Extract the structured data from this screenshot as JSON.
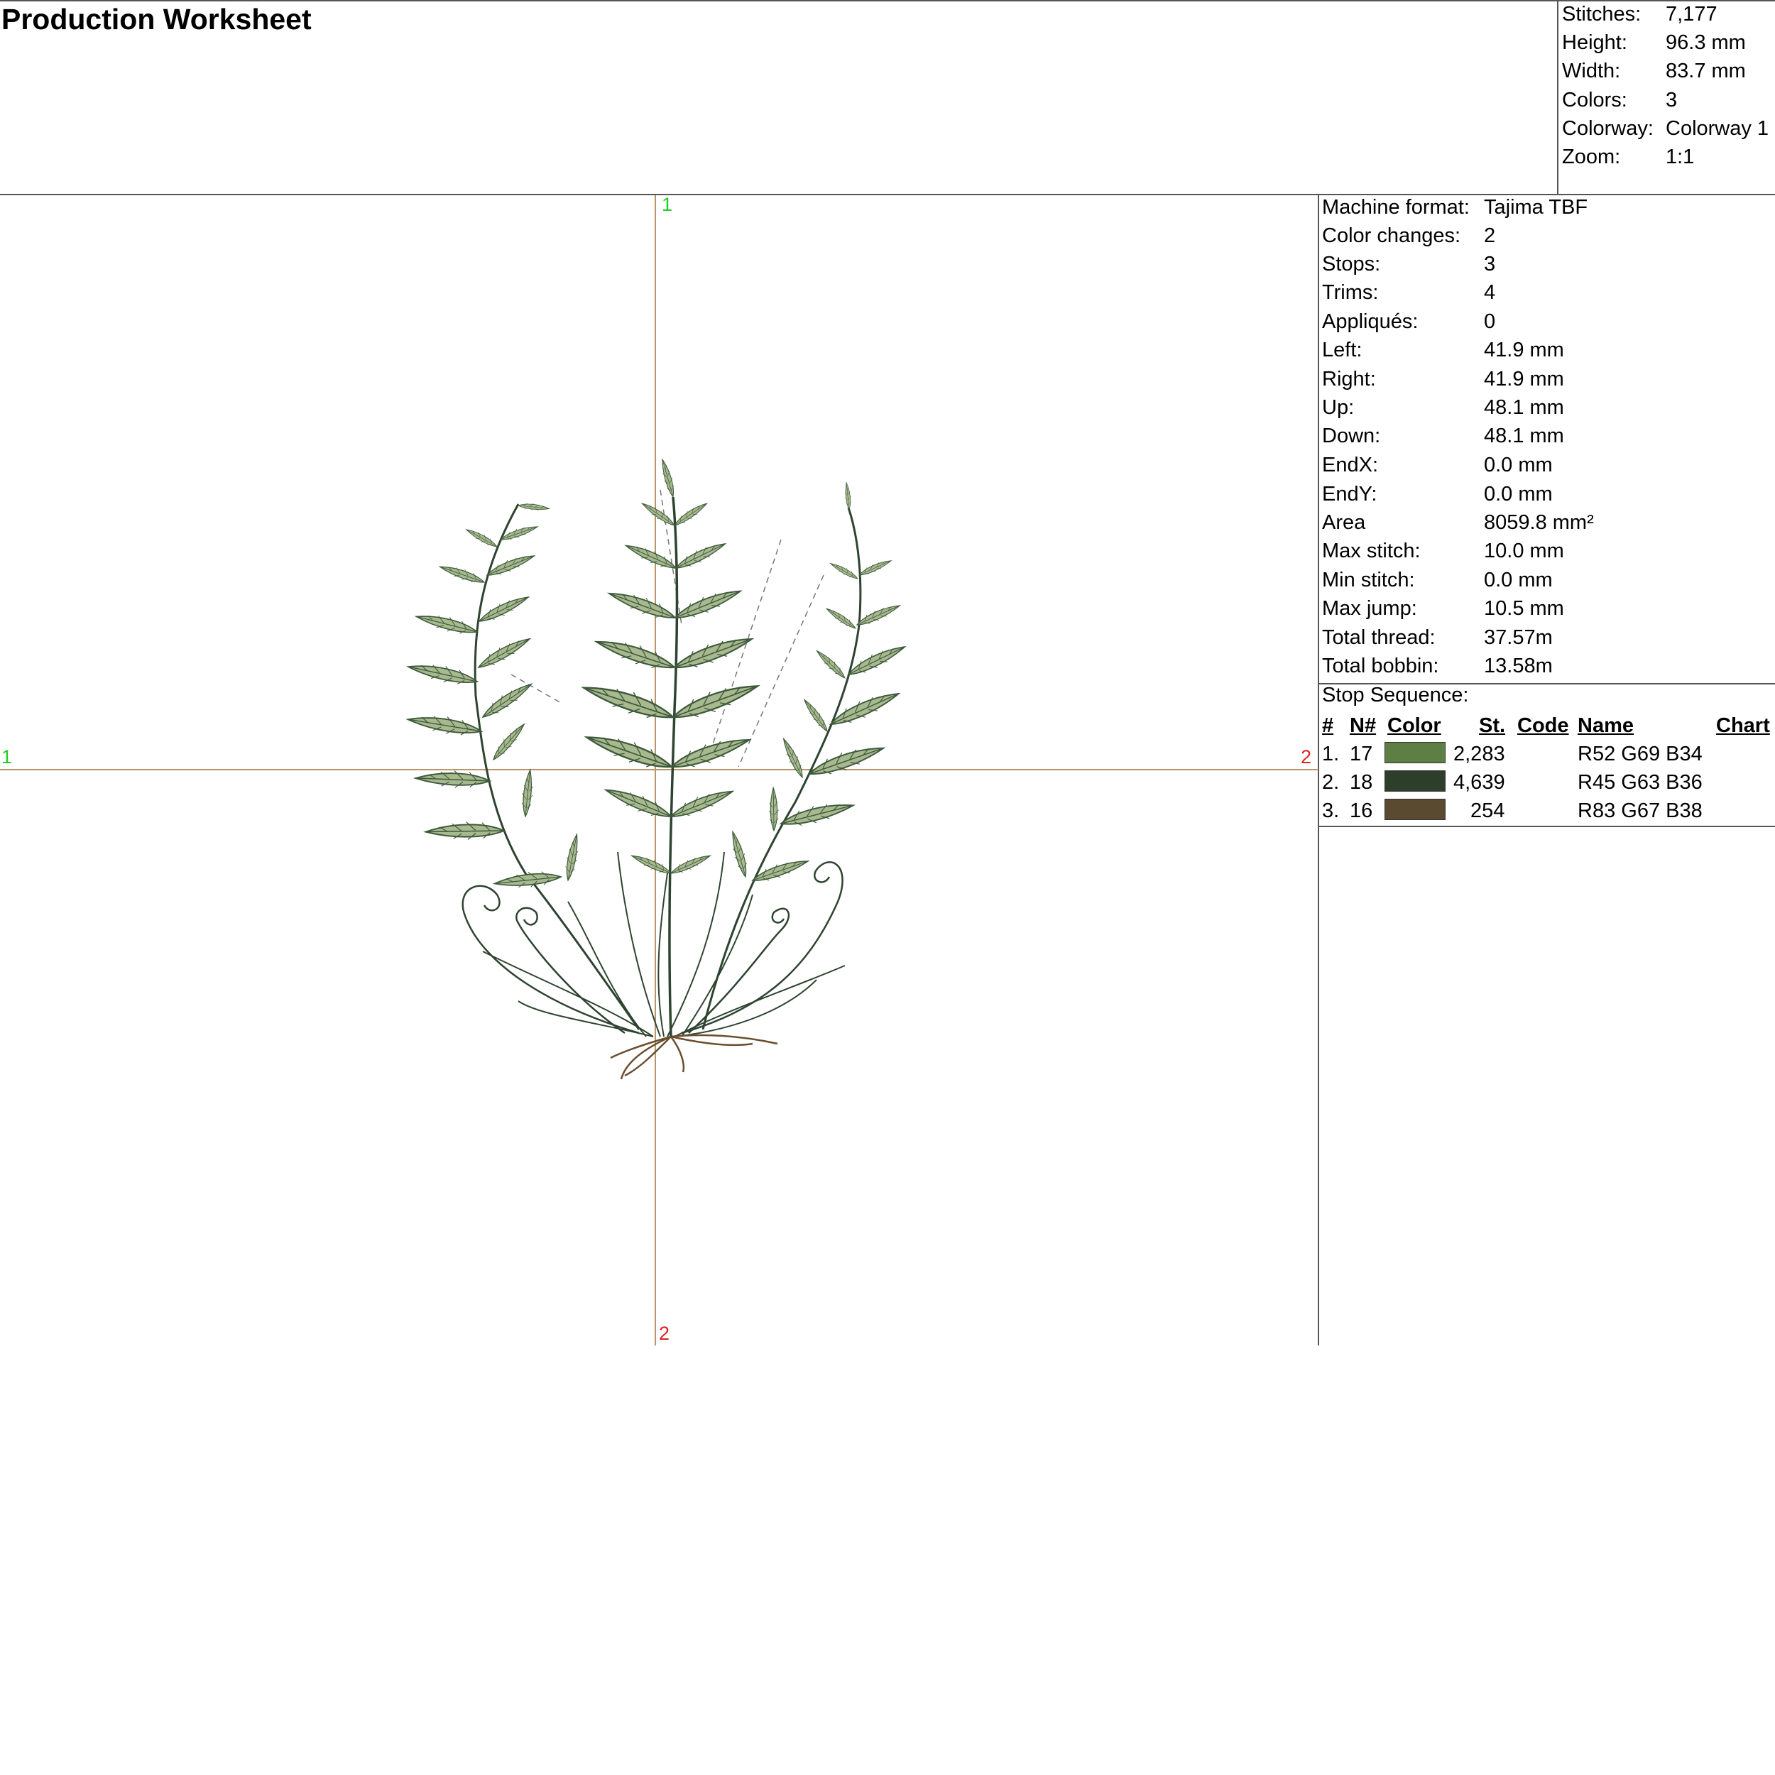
{
  "title": "Production Worksheet",
  "summary": [
    {
      "label": "Stitches:",
      "value": "7,177"
    },
    {
      "label": "Height:",
      "value": "96.3 mm"
    },
    {
      "label": "Width:",
      "value": "83.7 mm"
    },
    {
      "label": "Colors:",
      "value": "3"
    },
    {
      "label": "Colorway:",
      "value": "Colorway 1"
    },
    {
      "label": "Zoom:",
      "value": "1:1"
    }
  ],
  "details": [
    {
      "label": "Machine format:",
      "value": "Tajima TBF"
    },
    {
      "label": "Color changes:",
      "value": "2"
    },
    {
      "label": "Stops:",
      "value": "3"
    },
    {
      "label": "Trims:",
      "value": "4"
    },
    {
      "label": "Appliqués:",
      "value": "0"
    },
    {
      "label": "Left:",
      "value": "41.9 mm"
    },
    {
      "label": "Right:",
      "value": "41.9 mm"
    },
    {
      "label": "Up:",
      "value": "48.1 mm"
    },
    {
      "label": "Down:",
      "value": "48.1 mm"
    },
    {
      "label": "EndX:",
      "value": "0.0 mm"
    },
    {
      "label": "EndY:",
      "value": "0.0 mm"
    },
    {
      "label": "Area",
      "value": "8059.8 mm²"
    },
    {
      "label": "Max stitch:",
      "value": "10.0 mm"
    },
    {
      "label": "Min stitch:",
      "value": "0.0 mm"
    },
    {
      "label": "Max jump:",
      "value": "10.5 mm"
    },
    {
      "label": "Total thread:",
      "value": "37.57m"
    },
    {
      "label": "Total bobbin:",
      "value": "13.58m"
    }
  ],
  "stop_sequence": {
    "title": "Stop Sequence:",
    "headers": {
      "num": "#",
      "needle": "N#",
      "color": "Color",
      "stitches": "St.",
      "code": "Code",
      "name": "Name",
      "chart": "Chart"
    },
    "rows": [
      {
        "num": "1.",
        "needle": "17",
        "color": "#5e7f44",
        "stitches": "2,283",
        "code": "",
        "name": "R52 G69 B34",
        "chart": ""
      },
      {
        "num": "2.",
        "needle": "18",
        "color": "#2d3f2a",
        "stitches": "4,639",
        "code": "",
        "name": "R45 G63 B36",
        "chart": ""
      },
      {
        "num": "3.",
        "needle": "16",
        "color": "#5a4a30",
        "stitches": "254",
        "code": "",
        "name": "R83 G67 B38",
        "chart": ""
      }
    ]
  },
  "axes": {
    "top": "1",
    "bottom": "2",
    "left": "1",
    "right": "2"
  },
  "colors": {
    "leaf_light": "#a9b98f",
    "leaf_dark": "#3d5a3b",
    "stem": "#2e4430",
    "root": "#6b4e2e",
    "axis_line": "#b8956a"
  }
}
